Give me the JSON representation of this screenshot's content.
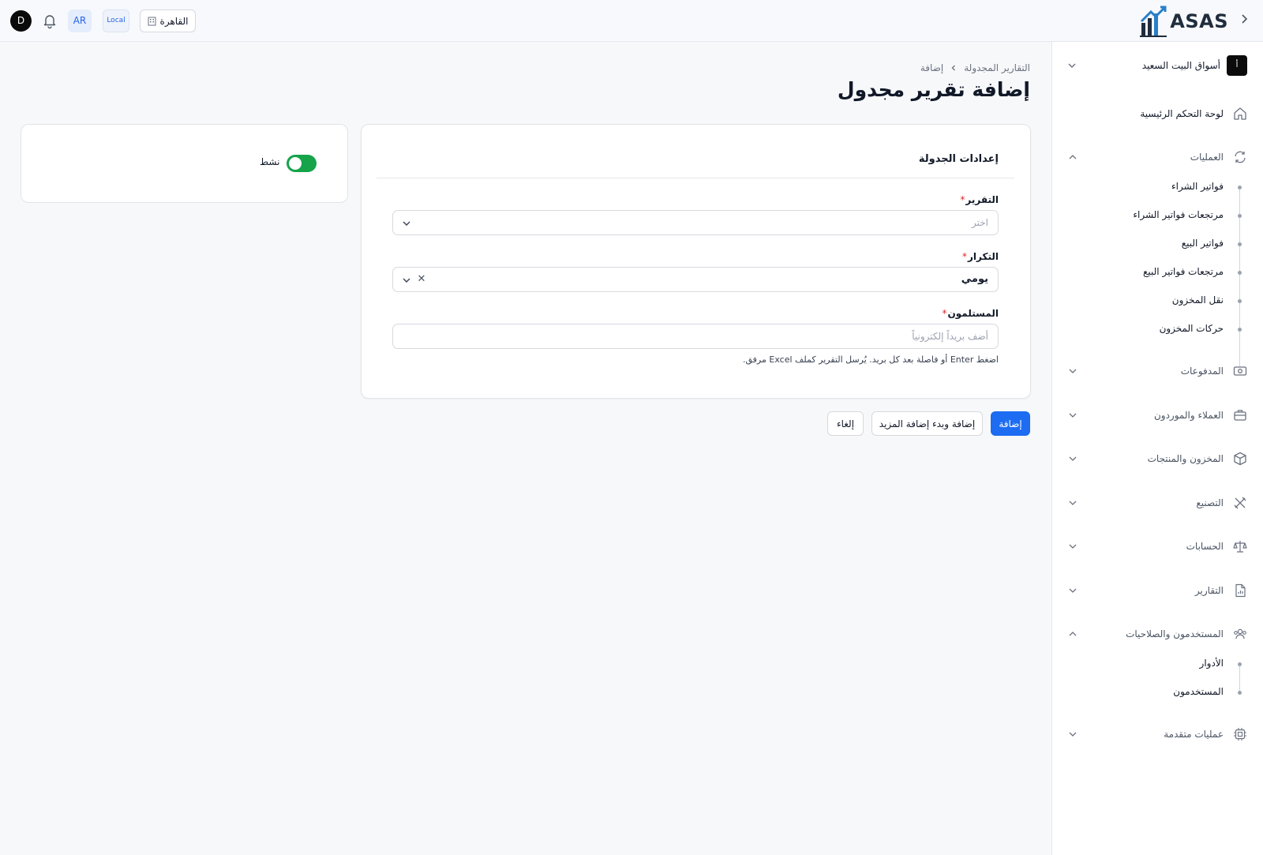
{
  "topbar": {
    "logo_text": "ASAS",
    "avatar_initial": "D",
    "language": "AR",
    "environment": "Local",
    "branch": "القاهرة"
  },
  "sidebar": {
    "org_name": "أسواق البيت السعيد",
    "org_logo_text": "أ",
    "items": [
      {
        "label": "لوحة التحكم الرئيسية",
        "icon": "home-icon"
      },
      {
        "label": "العمليات",
        "icon": "refresh-icon",
        "expanded": true,
        "children": [
          "فواتير الشراء",
          "مرتجعات فواتير الشراء",
          "فواتير البيع",
          "مرتجعات فواتير البيع",
          "نقل المخزون",
          "حركات المخزون"
        ]
      },
      {
        "label": "المدفوعات",
        "icon": "money-icon"
      },
      {
        "label": "العملاء والموردون",
        "icon": "briefcase-icon"
      },
      {
        "label": "المخزون والمنتجات",
        "icon": "box-icon"
      },
      {
        "label": "التصنيع",
        "icon": "tools-icon"
      },
      {
        "label": "الحسابات",
        "icon": "scale-icon"
      },
      {
        "label": "التقارير",
        "icon": "report-file-icon"
      },
      {
        "label": "المستخدمون والصلاحيات",
        "icon": "users-icon",
        "expanded": true,
        "children": [
          "الأدوار",
          "المستخدمون"
        ]
      },
      {
        "label": "عمليات متقدمة",
        "icon": "chip-icon"
      }
    ]
  },
  "main": {
    "breadcrumb": [
      "التقارير المجدولة",
      "إضافة"
    ],
    "title": "إضافة تقرير مجدول",
    "section_title": "إعدادات الجدولة",
    "fields": {
      "report": {
        "label": "التقرير",
        "placeholder": "اختر",
        "required": "*"
      },
      "frequency": {
        "label": "التكرار",
        "value": "يومي",
        "required": "*"
      },
      "recipients": {
        "label": "المستلمون",
        "placeholder": "أضف بريداً إلكترونياً",
        "required": "*"
      }
    },
    "hint": "اضغط Enter أو فاصلة بعد كل بريد. يُرسل التقرير كملف Excel مرفق.",
    "active_label": "نشط",
    "active": true,
    "buttons": {
      "add": "إضافة",
      "add_more": "إضافة وبدء إضافة المزيد",
      "cancel": "إلغاء"
    }
  },
  "colors": {
    "primary": "#1d6cf2",
    "toggle_on": "#16a34a",
    "required": "#dc2626"
  }
}
